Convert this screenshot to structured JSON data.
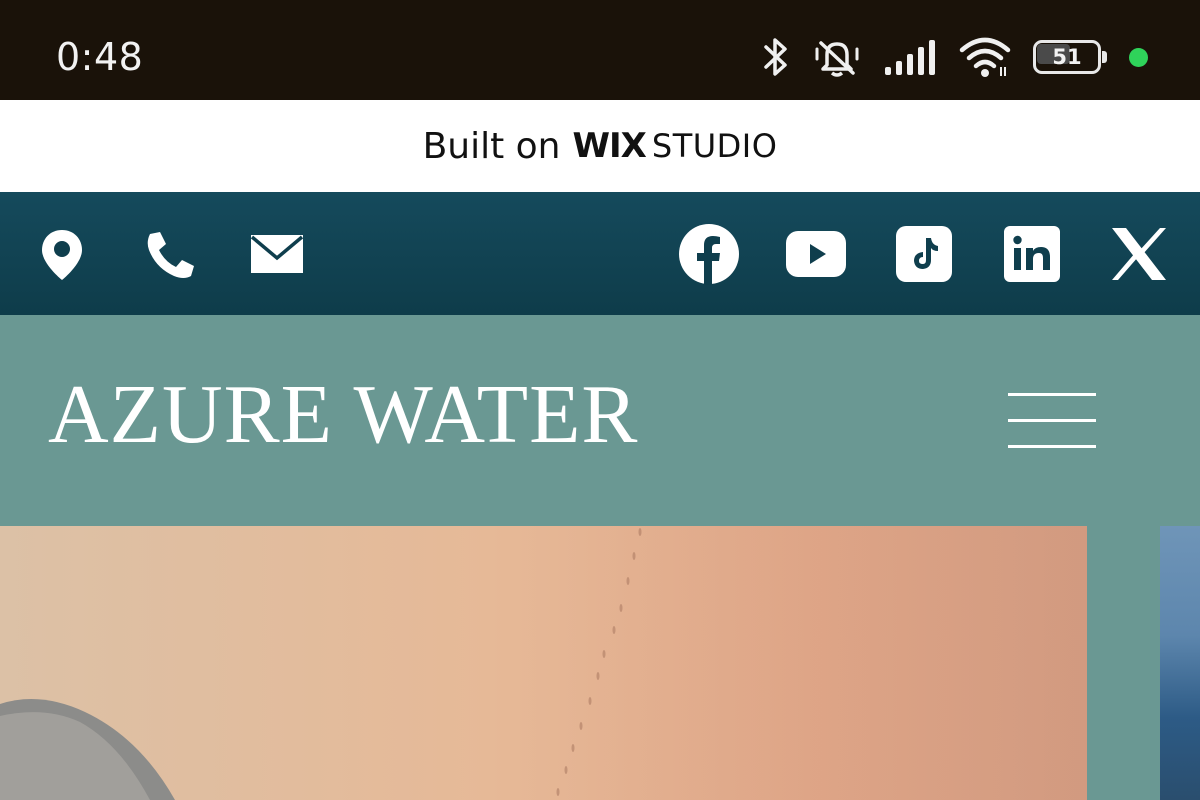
{
  "status_bar": {
    "time": "0:48",
    "battery_level": "51",
    "icons": [
      "bluetooth-icon",
      "mute-icon",
      "signal-icon",
      "wifi-icon",
      "battery-icon",
      "green-dot-indicator"
    ]
  },
  "wix_banner": {
    "built_on": "Built on",
    "brand": "WIX",
    "product": "STUDIO"
  },
  "contact_bar": {
    "icons": [
      "location-icon",
      "phone-icon",
      "email-icon"
    ],
    "social": [
      "facebook-icon",
      "youtube-icon",
      "tiktok-icon",
      "linkedin-icon",
      "x-icon"
    ]
  },
  "site_header": {
    "title": "AZURE WATER",
    "menu_icon": "hamburger-menu-icon"
  },
  "colors": {
    "status_bar_bg": "#1a1209",
    "contact_bar_bg": "#0f3e4d",
    "header_bg": "#6a9893",
    "accent_green": "#2fd35a"
  }
}
